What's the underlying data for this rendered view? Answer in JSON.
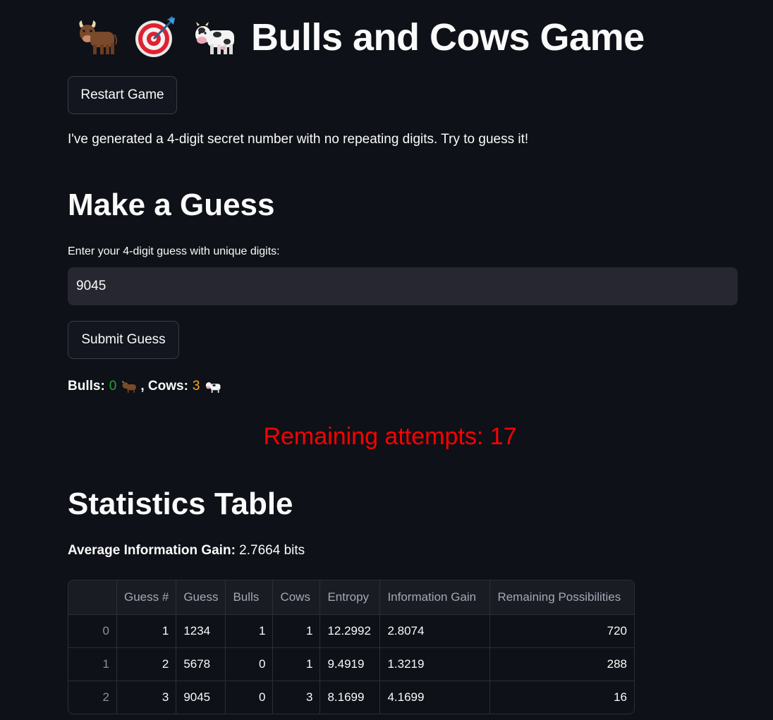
{
  "title": "Bulls and Cows Game",
  "restart_label": "Restart Game",
  "intro": "I've generated a 4-digit secret number with no repeating digits. Try to guess it!",
  "guess_section": {
    "heading": "Make a Guess",
    "input_label": "Enter your 4-digit guess with unique digits:",
    "input_value": "9045",
    "submit_label": "Submit Guess"
  },
  "result": {
    "bulls_label": "Bulls:",
    "bulls_value": "0",
    "cows_label": ", Cows:",
    "cows_value": "3"
  },
  "remaining_text": "Remaining attempts: 17",
  "stats": {
    "heading": "Statistics Table",
    "avg_label": "Average Information Gain:",
    "avg_value": "2.7664 bits",
    "columns": [
      "",
      "Guess #",
      "Guess",
      "Bulls",
      "Cows",
      "Entropy",
      "Information Gain",
      "Remaining Possibilities"
    ],
    "rows": [
      [
        "0",
        "1",
        "1234",
        "1",
        "1",
        "12.2992",
        "2.8074",
        "720"
      ],
      [
        "1",
        "2",
        "5678",
        "0",
        "1",
        "9.4919",
        "1.3219",
        "288"
      ],
      [
        "2",
        "3",
        "9045",
        "0",
        "3",
        "8.1699",
        "4.1699",
        "16"
      ]
    ]
  },
  "colors": {
    "background": "#0e1117",
    "bulls": "#21a336",
    "cows": "#ffa421",
    "remaining": "#ff0000"
  },
  "icons": [
    "bull-icon",
    "target-icon",
    "cow-icon"
  ]
}
